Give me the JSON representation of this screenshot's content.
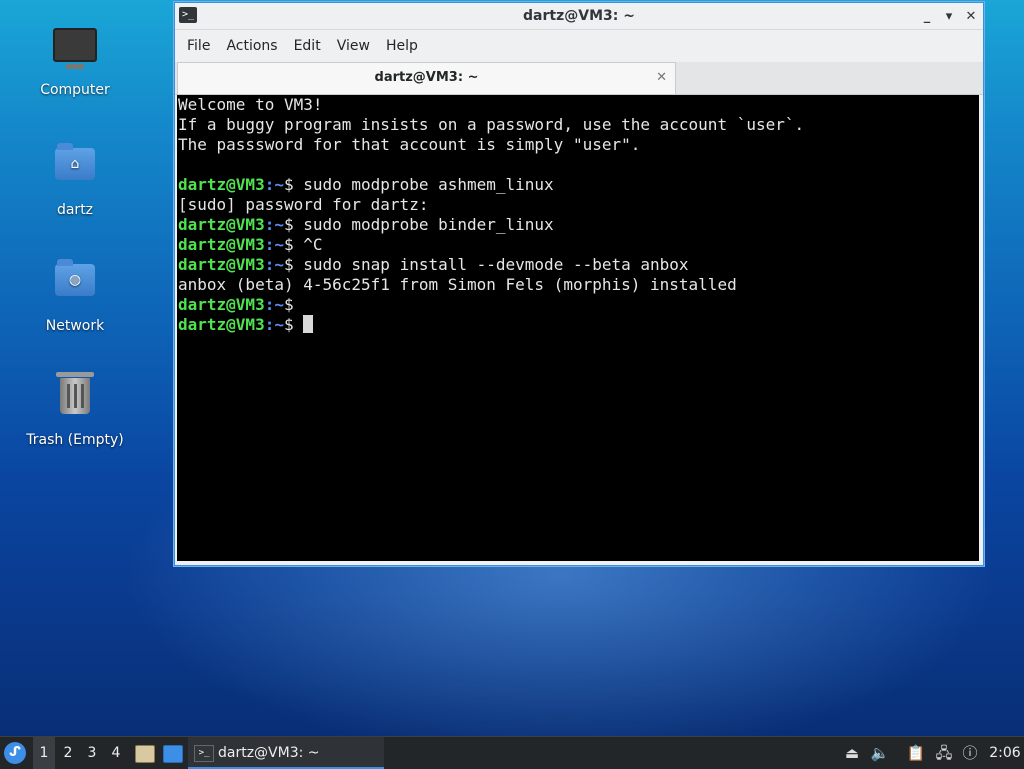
{
  "desktop": {
    "icons": [
      {
        "label": "Computer"
      },
      {
        "label": "dartz"
      },
      {
        "label": "Network"
      },
      {
        "label": "Trash (Empty)"
      }
    ]
  },
  "window": {
    "title": "dartz@VM3: ~",
    "controls": {
      "minimize": "_",
      "maximize": "⬝",
      "restore": "▾",
      "close": "✕"
    },
    "menu": [
      "File",
      "Actions",
      "Edit",
      "View",
      "Help"
    ],
    "tab": {
      "title": "dartz@VM3: ~",
      "close": "✕"
    }
  },
  "terminal": {
    "colors": {
      "prompt_user": "#4fe34f",
      "prompt_path": "#5b8cf0",
      "text": "#e6e6e6",
      "background": "#000000"
    },
    "lines": [
      {
        "text": "Welcome to VM3!"
      },
      {
        "text": "If a buggy program insists on a password, use the account `user`."
      },
      {
        "text": "The passsword for that account is simply \"user\"."
      },
      {
        "text": ""
      },
      {
        "prompt": "dartz@VM3",
        "path": ":~",
        "symbol": "$ ",
        "text": "sudo modprobe ashmem_linux"
      },
      {
        "text": "[sudo] password for dartz:"
      },
      {
        "prompt": "dartz@VM3",
        "path": ":~",
        "symbol": "$ ",
        "text": "sudo modprobe binder_linux"
      },
      {
        "prompt": "dartz@VM3",
        "path": ":~",
        "symbol": "$ ",
        "text": "^C"
      },
      {
        "prompt": "dartz@VM3",
        "path": ":~",
        "symbol": "$ ",
        "text": "sudo snap install --devmode --beta anbox"
      },
      {
        "text": "anbox (beta) 4-56c25f1 from Simon Fels (morphis) installed"
      },
      {
        "prompt": "dartz@VM3",
        "path": ":~",
        "symbol": "$ ",
        "text": ""
      },
      {
        "prompt": "dartz@VM3",
        "path": ":~",
        "symbol": "$ ",
        "text": "",
        "cursor": true
      }
    ]
  },
  "taskbar": {
    "workspaces": [
      "1",
      "2",
      "3",
      "4"
    ],
    "active_workspace": "1",
    "task_label": "dartz@VM3: ~",
    "tray_icons": [
      "eject-icon",
      "volume-icon",
      "clipboard-icon",
      "network-icon",
      "update-notifier-icon"
    ],
    "clock": "2:06"
  }
}
